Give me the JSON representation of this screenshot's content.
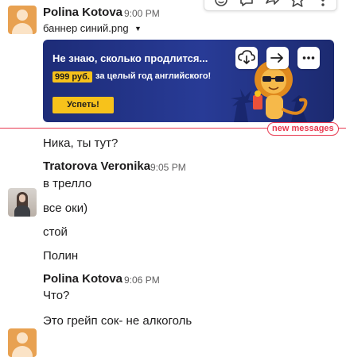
{
  "colors": {
    "divider": "#e8384f",
    "banner_bg": "#1d2c78",
    "accent_yellow": "#f7c21b"
  },
  "toolbar": {
    "icons": [
      "emoji-reaction-icon",
      "reply-thread-icon",
      "share-icon",
      "star-icon",
      "more-icon"
    ]
  },
  "messages": [
    {
      "author": "Polina Kotova",
      "time": "9:00 PM",
      "attachment": {
        "file_name": "баннер синий.png",
        "banner": {
          "title": "Не знаю, сколько продлится...",
          "price": "999 руб.",
          "promo": "за целый год английского!",
          "cta": "Успеть!"
        }
      },
      "lines": [
        "Ника, ты тут?"
      ]
    },
    {
      "author": "Tratorova Veronika",
      "time": "9:05 PM",
      "lines": [
        "в трелло",
        "все оки)",
        "стой",
        "Полин"
      ]
    },
    {
      "author": "Polina Kotova",
      "time": "9:06 PM",
      "lines": [
        "Что?",
        "Это грейп сок- не алкоголь"
      ]
    }
  ],
  "divider": {
    "label": "new messages"
  }
}
